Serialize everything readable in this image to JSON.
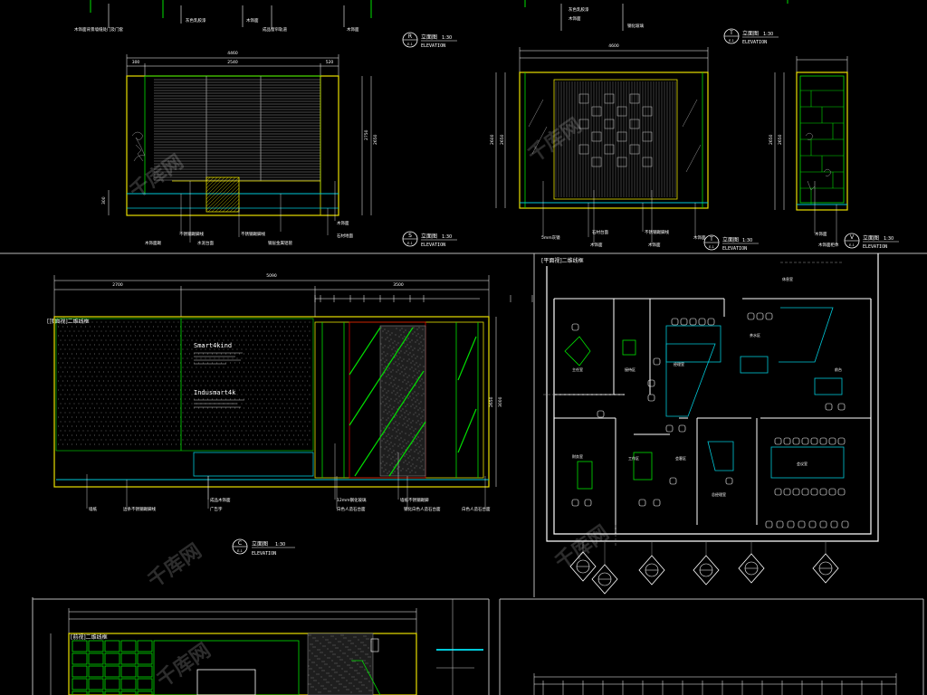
{
  "colors": {
    "background": "#000000",
    "frame": "#b8b8b8",
    "green": "#00e000",
    "yellow": "#e8e000",
    "cyan": "#00c8d8",
    "white": "#ffffff",
    "gray": "#9a9a9a",
    "red": "#d00000"
  },
  "elevation_R": {
    "circle_letter": "R",
    "circle_sheet": "E-1",
    "title": "立面图",
    "scale": "1:30",
    "subtitle": "ELEVATION",
    "dims_top": [
      "300",
      "2540",
      "520"
    ],
    "total_width": "4460",
    "dims_right": [
      "2750",
      "2650"
    ],
    "dims_left": [
      "300"
    ],
    "notes_top": [
      "木饰面背景墙缝处门及门套",
      "灰色乳胶漆",
      "木饰面",
      "鞋面收口",
      "成品窗帘轨道",
      "木饰面"
    ],
    "notes_bottom": [
      "木饰面踢",
      "不锈钢踢脚线",
      "水泥台面",
      "不锈钢踢脚线",
      "钢层金属铝管",
      "木饰面",
      "石材地面"
    ]
  },
  "elevation_S": {
    "circle_letter": "S",
    "circle_sheet": "E-1",
    "title": "立面图",
    "scale": "1:30",
    "subtitle": "ELEVATION",
    "dims_top": [
      "4600"
    ],
    "dims_left": [
      "2600",
      "2650"
    ],
    "notes_top": [
      "灰色乳胶漆",
      "木饰面",
      "钢化玻璃"
    ],
    "notes_bottom": [
      "5mm灰镜",
      "石材台面",
      "木饰面",
      "不锈钢踢脚线",
      "木饰面",
      "木饰面"
    ]
  },
  "elevation_T": {
    "circle_letter": "T",
    "circle_sheet": "E-1",
    "title": "立面图",
    "scale": "1:30",
    "subtitle": "ELEVATION"
  },
  "elevation_V": {
    "circle_letter": "V",
    "circle_sheet": "E-1",
    "title": "立面图",
    "scale": "1:30",
    "subtitle": "ELEVATION",
    "dims_left": [
      "2650",
      "2650"
    ],
    "notes_bottom": [
      "木饰面",
      "木饰面柜体"
    ]
  },
  "elevation_C": {
    "circle_letter": "C",
    "circle_sheet": "E-1",
    "title": "立面图",
    "scale": "1:30",
    "subtitle": "ELEVATION",
    "tag": "[顶面视]二维线框",
    "dims_top_total": "5090",
    "dims_top": [
      "2700",
      "3500"
    ],
    "dims_top_small": [
      "100",
      "250",
      "300",
      "250",
      "300",
      "250",
      "300",
      "250",
      "1600",
      "400",
      "250"
    ],
    "dims_right": [
      "2650",
      "3000"
    ],
    "signage_1": "Smart4kind",
    "signage_2": "Indusmart4k",
    "notes_bottom": [
      "墙纸",
      "边条不锈钢踢脚线",
      "成品木饰面",
      "广告字",
      "12mm钢化玻璃",
      "白色人造石台面",
      "墙纸不锈钢踢脚",
      "钢化白色人造石台面",
      "白色人造石台面"
    ]
  },
  "floor_plan": {
    "tag": "[平面视]二维线框",
    "rooms": [
      "主任室",
      "接待区",
      "经理室",
      "财务室",
      "工作区",
      "前台",
      "会议室",
      "茶水区",
      "总经理室",
      "休息室",
      "会客区"
    ],
    "markers": [
      "R",
      "S",
      "T",
      "V",
      "C"
    ]
  },
  "bottom_left": {
    "tag": "[前视]二维线框"
  },
  "watermark": "千库网"
}
